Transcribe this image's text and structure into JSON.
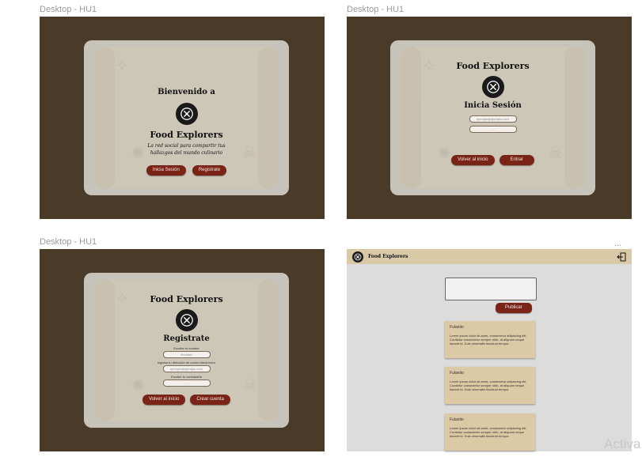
{
  "labels": {
    "frame1": "Desktop - HU1",
    "frame2": "Desktop - HU1",
    "frame3": "Desktop - HU1",
    "frame4_dots": "..."
  },
  "welcome": {
    "greeting": "Bienvenido a",
    "app_name": "Food Explorers",
    "tagline_line1": "La red social para compartir tus",
    "tagline_line2": "hallazgos del mundo culinario",
    "login_button": "Inicia Sesión",
    "register_button": "Registrate"
  },
  "login": {
    "app_name": "Food Explorers",
    "heading": "Inicia Sesión",
    "email_placeholder": "ejemplo@ejemplo.com",
    "password_placeholder": "......",
    "back_button": "Volver al inicio",
    "enter_button": "Entrar"
  },
  "register": {
    "app_name": "Food Explorers",
    "heading": "Registrate",
    "name_label": "Escribe tu nombre",
    "name_placeholder": "Nombre",
    "email_label": "Ingresa tu dirección de correo electrónico",
    "email_placeholder": "ejemplo@ejemplo.com",
    "password_label": "Escribe tu contraseña",
    "password_placeholder": "......",
    "back_button": "Volver al inicio",
    "create_button": "Crear cuenta"
  },
  "feed": {
    "app_name": "Food Explorers",
    "publish_button": "Publicar",
    "posts": [
      {
        "user": "Fulanito",
        "text": "Lorem ipsum dolor sit amet, consectetur adipiscing elit. Curabitur consectetur semper nibh, at aliquam neque laoreet id. Duis venenatis tincidunt tempor."
      },
      {
        "user": "Fulanito",
        "text": "Lorem ipsum dolor sit amet, consectetur adipiscing elit. Curabitur consectetur semper nibh, at aliquam neque laoreet id. Duis venenatis tincidunt tempor."
      },
      {
        "user": "Fulanito",
        "text": "Lorem ipsum dolor sit amet, consectetur adipiscing elit. Curabitur consectetur semper nibh, at aliquam neque laoreet id. Duis venenatis tincidunt tempor."
      }
    ]
  },
  "watermark": "Activa",
  "colors": {
    "frame_bg": "#4a3a28",
    "button": "#7a2418",
    "topbar": "#d9c9a6",
    "post_card": "#dcc9a5"
  }
}
